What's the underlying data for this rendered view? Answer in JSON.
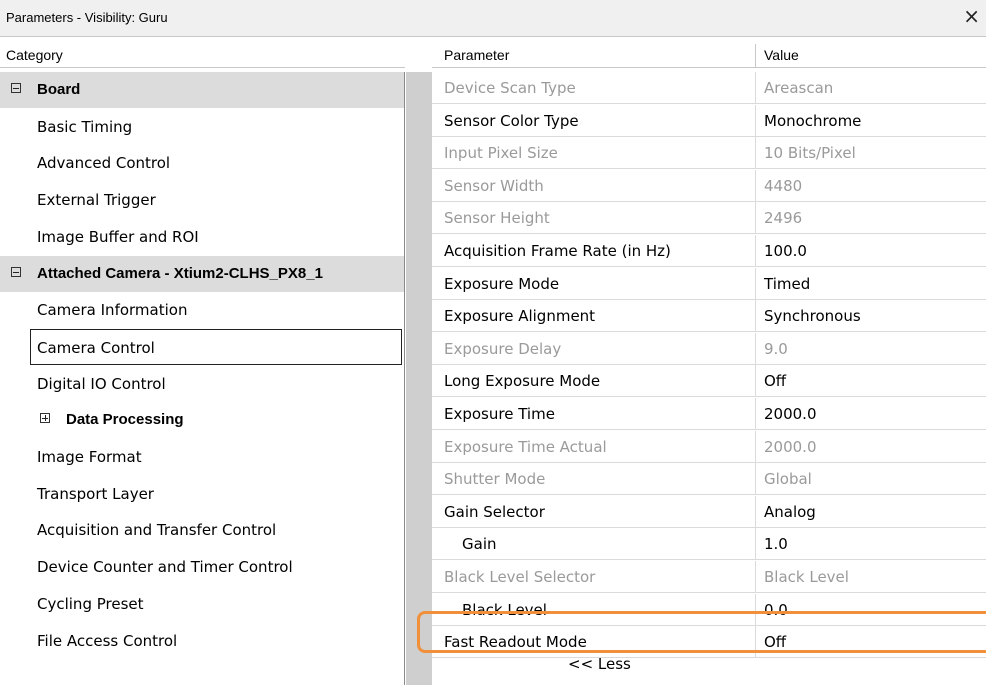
{
  "window": {
    "title": "Parameters - Visibility: Guru",
    "close_glyph": "×"
  },
  "category_panel": {
    "header": "Category",
    "items": [
      {
        "label": "Board",
        "type": "group",
        "expander": "minus"
      },
      {
        "label": "Basic Timing",
        "type": "item"
      },
      {
        "label": "Advanced Control",
        "type": "item"
      },
      {
        "label": "External Trigger",
        "type": "item"
      },
      {
        "label": "Image Buffer and ROI",
        "type": "item"
      },
      {
        "label": "Attached Camera - Xtium2-CLHS_PX8_1",
        "type": "group",
        "expander": "minus"
      },
      {
        "label": "Camera Information",
        "type": "item"
      },
      {
        "label": "Camera Control",
        "type": "item",
        "selected": true
      },
      {
        "label": "Digital IO Control",
        "type": "item"
      },
      {
        "label": "Data Processing",
        "type": "subgroup",
        "expander": "plus"
      },
      {
        "label": "Image Format",
        "type": "item"
      },
      {
        "label": "Transport Layer",
        "type": "item"
      },
      {
        "label": "Acquisition and Transfer Control",
        "type": "item"
      },
      {
        "label": "Device Counter and Timer Control",
        "type": "item"
      },
      {
        "label": "Cycling Preset",
        "type": "item"
      },
      {
        "label": "File Access Control",
        "type": "item"
      }
    ]
  },
  "parameter_grid": {
    "headers": {
      "parameter": "Parameter",
      "value": "Value"
    },
    "rows": [
      {
        "name": "Device Scan Type",
        "value": "Areascan",
        "readonly": true
      },
      {
        "name": "Sensor Color Type",
        "value": "Monochrome",
        "readonly": false
      },
      {
        "name": "Input Pixel Size",
        "value": "10 Bits/Pixel",
        "readonly": true
      },
      {
        "name": "Sensor Width",
        "value": "4480",
        "readonly": true
      },
      {
        "name": "Sensor Height",
        "value": "2496",
        "readonly": true
      },
      {
        "name": "Acquisition Frame Rate (in Hz)",
        "value": "100.0",
        "readonly": false
      },
      {
        "name": "Exposure Mode",
        "value": "Timed",
        "readonly": false
      },
      {
        "name": "Exposure Alignment",
        "value": "Synchronous",
        "readonly": false
      },
      {
        "name": "Exposure Delay",
        "value": "9.0",
        "readonly": true
      },
      {
        "name": "Long Exposure Mode",
        "value": "Off",
        "readonly": false
      },
      {
        "name": "Exposure Time",
        "value": "2000.0",
        "readonly": false
      },
      {
        "name": "Exposure Time Actual",
        "value": "2000.0",
        "readonly": true
      },
      {
        "name": "Shutter Mode",
        "value": "Global",
        "readonly": true
      },
      {
        "name": "Gain Selector",
        "value": "Analog",
        "readonly": false
      },
      {
        "name": "Gain",
        "value": "1.0",
        "readonly": false,
        "indent": true
      },
      {
        "name": "Black Level Selector",
        "value": "Black Level",
        "readonly": true
      },
      {
        "name": "Black Level",
        "value": "0.0",
        "readonly": false,
        "indent": true
      },
      {
        "name": "Fast Readout Mode",
        "value": "Off",
        "readonly": false,
        "highlighted": true
      }
    ],
    "less_button": "<< Less"
  },
  "colors": {
    "highlight": "#f0903a",
    "readonly_text": "#9a9a9a",
    "group_background": "#dcdcdc",
    "gutter": "#cfcfcf"
  }
}
